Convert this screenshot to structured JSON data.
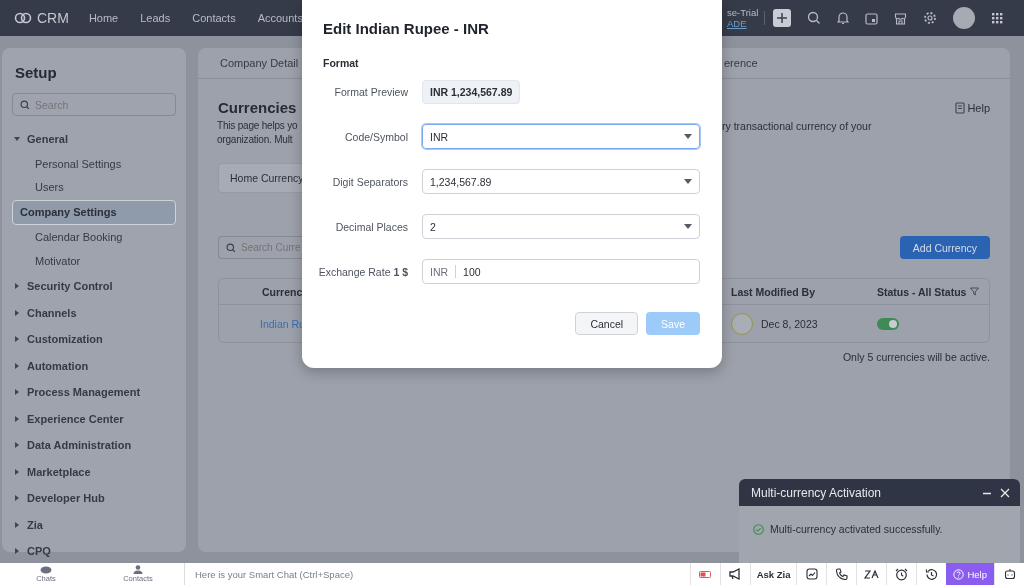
{
  "top_bar": {
    "app_name": "CRM",
    "nav": [
      {
        "label": "Home"
      },
      {
        "label": "Leads"
      },
      {
        "label": "Contacts"
      },
      {
        "label": "Accounts"
      }
    ],
    "trial": {
      "text": "se-Trial",
      "link": "ADE"
    }
  },
  "sidebar": {
    "title": "Setup",
    "search": {
      "placeholder": "Search"
    },
    "items": [
      {
        "label": "General",
        "expanded": true,
        "children": [
          {
            "label": "Personal Settings",
            "selected": false
          },
          {
            "label": "Users",
            "selected": false
          },
          {
            "label": "Company Settings",
            "selected": true
          },
          {
            "label": "Calendar Booking",
            "selected": false
          },
          {
            "label": "Motivator",
            "selected": false
          }
        ]
      },
      {
        "label": "Security Control",
        "expanded": false
      },
      {
        "label": "Channels",
        "expanded": false
      },
      {
        "label": "Customization",
        "expanded": false
      },
      {
        "label": "Automation",
        "expanded": false
      },
      {
        "label": "Process Management",
        "expanded": false
      },
      {
        "label": "Experience Center",
        "expanded": false
      },
      {
        "label": "Data Administration",
        "expanded": false
      },
      {
        "label": "Marketplace",
        "expanded": false
      },
      {
        "label": "Developer Hub",
        "expanded": false
      },
      {
        "label": "Zia",
        "expanded": false
      },
      {
        "label": "CPQ",
        "expanded": false
      }
    ]
  },
  "content": {
    "tabs": [
      {
        "label": "Company Detail"
      },
      {
        "label": "erence"
      }
    ],
    "title": "Currencies",
    "help": "Help",
    "description_left": [
      "This page helps yo",
      "organization. Mult"
    ],
    "description_right": "ry transactional currency of your",
    "home_currency": "Home Currency",
    "search": {
      "placeholder": "Search Curre"
    },
    "add_button": "Add Currency",
    "table": {
      "columns": [
        "Currenc",
        "Last Modified By",
        "Status - All Status"
      ],
      "rows": [
        {
          "currency": "Indian Ru",
          "modified": "Dec 8, 2023",
          "active": true
        }
      ]
    },
    "note": "Only 5 currencies will be active."
  },
  "dialog": {
    "title": "Edit Indian Rupee - INR",
    "section": "Format",
    "fields": [
      {
        "kind": "preview",
        "label": "Format Preview",
        "value": "INR 1,234,567.89"
      },
      {
        "kind": "select",
        "label": "Code/Symbol",
        "value": "INR",
        "focused": true
      },
      {
        "kind": "select",
        "label": "Digit Separators",
        "value": "1,234,567.89",
        "focused": false
      },
      {
        "kind": "select",
        "label": "Decimal Places",
        "value": "2",
        "focused": false
      },
      {
        "kind": "prefixed",
        "label": "Exchange Rate **1 $**",
        "prefix": "INR",
        "value": "100"
      }
    ],
    "buttons": [
      {
        "label": "Cancel",
        "kind": "secondary",
        "disabled": false
      },
      {
        "label": "Save",
        "kind": "primary",
        "disabled": true
      }
    ]
  },
  "toast": {
    "title": "Multi-currency Activation",
    "message": "Multi-currency activated successfully."
  },
  "bottom_bar": {
    "shortcuts": [
      {
        "label": "Chats",
        "kind": "chat"
      },
      {
        "label": "Contacts",
        "kind": "contact"
      }
    ],
    "chat": {
      "placeholder": "Here is your Smart Chat (Ctrl+Space)"
    },
    "ask_zia": "Ask Zia",
    "help": "Help"
  }
}
